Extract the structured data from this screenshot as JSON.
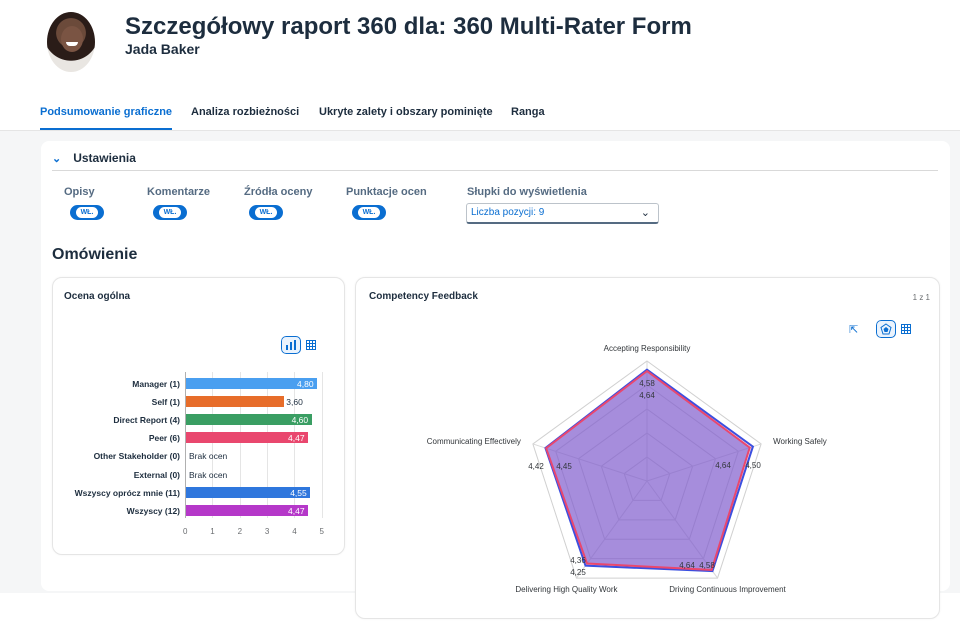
{
  "header": {
    "title": "Szczegółowy raport 360 dla: 360 Multi-Rater Form",
    "subtitle": "Jada Baker"
  },
  "tabs": [
    {
      "label": "Podsumowanie graficzne",
      "active": true
    },
    {
      "label": "Analiza rozbieżności",
      "active": false
    },
    {
      "label": "Ukryte zalety i obszary pominięte",
      "active": false
    },
    {
      "label": "Ranga",
      "active": false
    }
  ],
  "settings": {
    "title": "Ustawienia",
    "options": [
      {
        "label": "Opisy",
        "toggle": "WŁ."
      },
      {
        "label": "Komentarze",
        "toggle": "WŁ."
      },
      {
        "label": "Źródła oceny",
        "toggle": "WŁ."
      },
      {
        "label": "Punktacje ocen",
        "toggle": "WŁ."
      }
    ],
    "bars_label": "Słupki do wyświetlenia",
    "bars_value": "Liczba pozycji: 9"
  },
  "overview_title": "Omówienie",
  "overall_card": {
    "title": "Ocena ogólna",
    "no_results": "Brak ocen"
  },
  "competency_card": {
    "title": "Competency Feedback",
    "pager": "1 z 1"
  },
  "chart_data": [
    {
      "type": "bar",
      "orientation": "horizontal",
      "categories": [
        "Manager (1)",
        "Self (1)",
        "Direct Report (4)",
        "Peer (6)",
        "Other Stakeholder (0)",
        "External (0)",
        "Wszyscy oprócz mnie (11)",
        "Wszyscy (12)"
      ],
      "values": [
        4.8,
        3.6,
        4.6,
        4.47,
        null,
        null,
        4.55,
        4.47
      ],
      "value_labels": [
        "4,80",
        "3,60",
        "4,60",
        "4,47",
        "Brak ocen",
        "Brak ocen",
        "4,55",
        "4,47"
      ],
      "colors": [
        "#4a9ff0",
        "#e76d2a",
        "#3a9e63",
        "#e9476e",
        null,
        null,
        "#2f77dd",
        "#b538c9"
      ],
      "xticks": [
        "0",
        "1",
        "2",
        "3",
        "4",
        "5"
      ],
      "xlim": [
        0,
        5
      ]
    },
    {
      "type": "radar",
      "axes": [
        "Accepting Responsibility",
        "Working Safely",
        "Driving Continuous Improvement",
        "Delivering High Quality Work",
        "Communicating Effectively"
      ],
      "series": [
        {
          "values": [
            4.58,
            4.5,
            4.58,
            4.25,
            4.42
          ],
          "labels": [
            "4,58",
            "4,50",
            "4,58",
            "4,25",
            "4,42"
          ],
          "color": "#e9476e"
        },
        {
          "values": [
            4.64,
            4.64,
            4.64,
            4.36,
            4.45
          ],
          "labels": [
            "4,64",
            "4,64",
            "4,64",
            "4,36",
            "4,45"
          ],
          "color": "#3b4fe0"
        }
      ],
      "range": [
        0,
        5
      ]
    }
  ]
}
